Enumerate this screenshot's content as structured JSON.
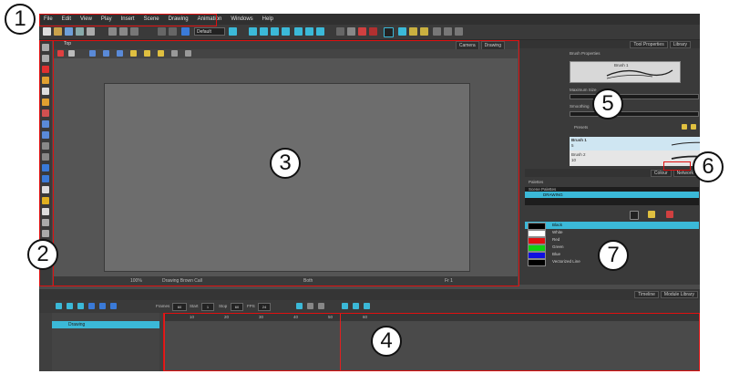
{
  "menu": [
    "File",
    "Edit",
    "View",
    "Play",
    "Insert",
    "Scene",
    "Drawing",
    "Animation",
    "Windows",
    "Help"
  ],
  "toolbar": {
    "preset": "Default"
  },
  "camera_view": {
    "tab_label": "Top",
    "tabs": [
      "Camera",
      "Drawing"
    ],
    "status_zoom": "100%",
    "status_layer": "Drawing Brown Call",
    "status_mode": "Both",
    "status_frame": "Fr 1"
  },
  "tool_properties": {
    "tabs": [
      "Tool Properties",
      "Library"
    ],
    "title": "Brush Properties",
    "brush_label": "Brush 1",
    "max_size_label": "Maximum Size",
    "max_size_value": "3",
    "smoothing_label": "Smoothing",
    "smoothing_value": "3",
    "presets_label": "Presets",
    "presets": [
      {
        "name": "Brush 1",
        "size": "5"
      },
      {
        "name": "Brush 2",
        "size": "10"
      }
    ]
  },
  "colour_panel": {
    "tabs": [
      "Colour",
      "Network"
    ],
    "palettes_label": "Palettes",
    "palette_header": "Scene Palettes",
    "selected_palette": "DRAWING",
    "colours": [
      {
        "name": "Black",
        "hex": "#000000",
        "selected": true
      },
      {
        "name": "White",
        "hex": "#ffffff",
        "selected": false
      },
      {
        "name": "Red",
        "hex": "#e01010",
        "selected": false
      },
      {
        "name": "Green",
        "hex": "#10d010",
        "selected": false
      },
      {
        "name": "Blue",
        "hex": "#1010e0",
        "selected": false
      },
      {
        "name": "Vectorized Line",
        "hex": "#000000",
        "selected": false
      }
    ]
  },
  "timeline": {
    "tabs": [
      "Timeline",
      "Module Library"
    ],
    "frames_label": "Frames",
    "frames_value": "60",
    "start_label": "Start",
    "start_value": "1",
    "stop_label": "Stop",
    "stop_value": "60",
    "fps_label": "FPS",
    "fps_value": "24",
    "layer_name": "Drawing",
    "ruler_marks": [
      "10",
      "20",
      "30",
      "40",
      "50",
      "60"
    ]
  },
  "callouts": [
    "1",
    "2",
    "3",
    "4",
    "5",
    "6",
    "7"
  ],
  "colors": {
    "highlight": "#e01010",
    "accent": "#3bb9d8"
  }
}
